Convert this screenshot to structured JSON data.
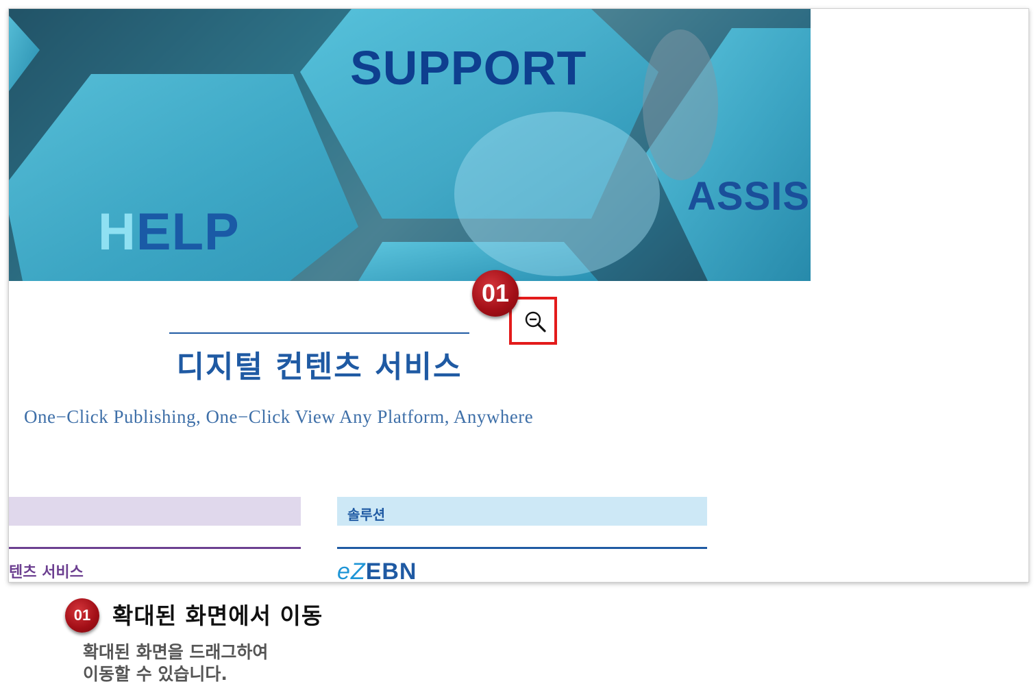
{
  "hero": {
    "word_support": "SUPPORT",
    "word_help_faded": "H",
    "word_help_rest": "ELP",
    "word_assist": "ASSIS"
  },
  "content": {
    "title": "디지털 컨텐츠 서비스",
    "subtitle": "One−Click Publishing, One−Click View Any Platform, Anywhere",
    "left_section_text": "텐츠 서비스",
    "right_section_label": "솔루션",
    "logo_ez": "eZ",
    "logo_rest": "EBN"
  },
  "callout": {
    "number": "01",
    "icon": "zoom-out-icon",
    "highlight_color": "#e31b1b"
  },
  "legend": {
    "number": "01",
    "heading": "확대된 화면에서 이동",
    "desc_line1": "확대된 화면을 드래그하여",
    "desc_line2": "이동할 수 있습니다."
  },
  "colors": {
    "brand_blue": "#1f5aa3",
    "brand_purple": "#6c3f90",
    "badge_red": "#a10e16"
  }
}
